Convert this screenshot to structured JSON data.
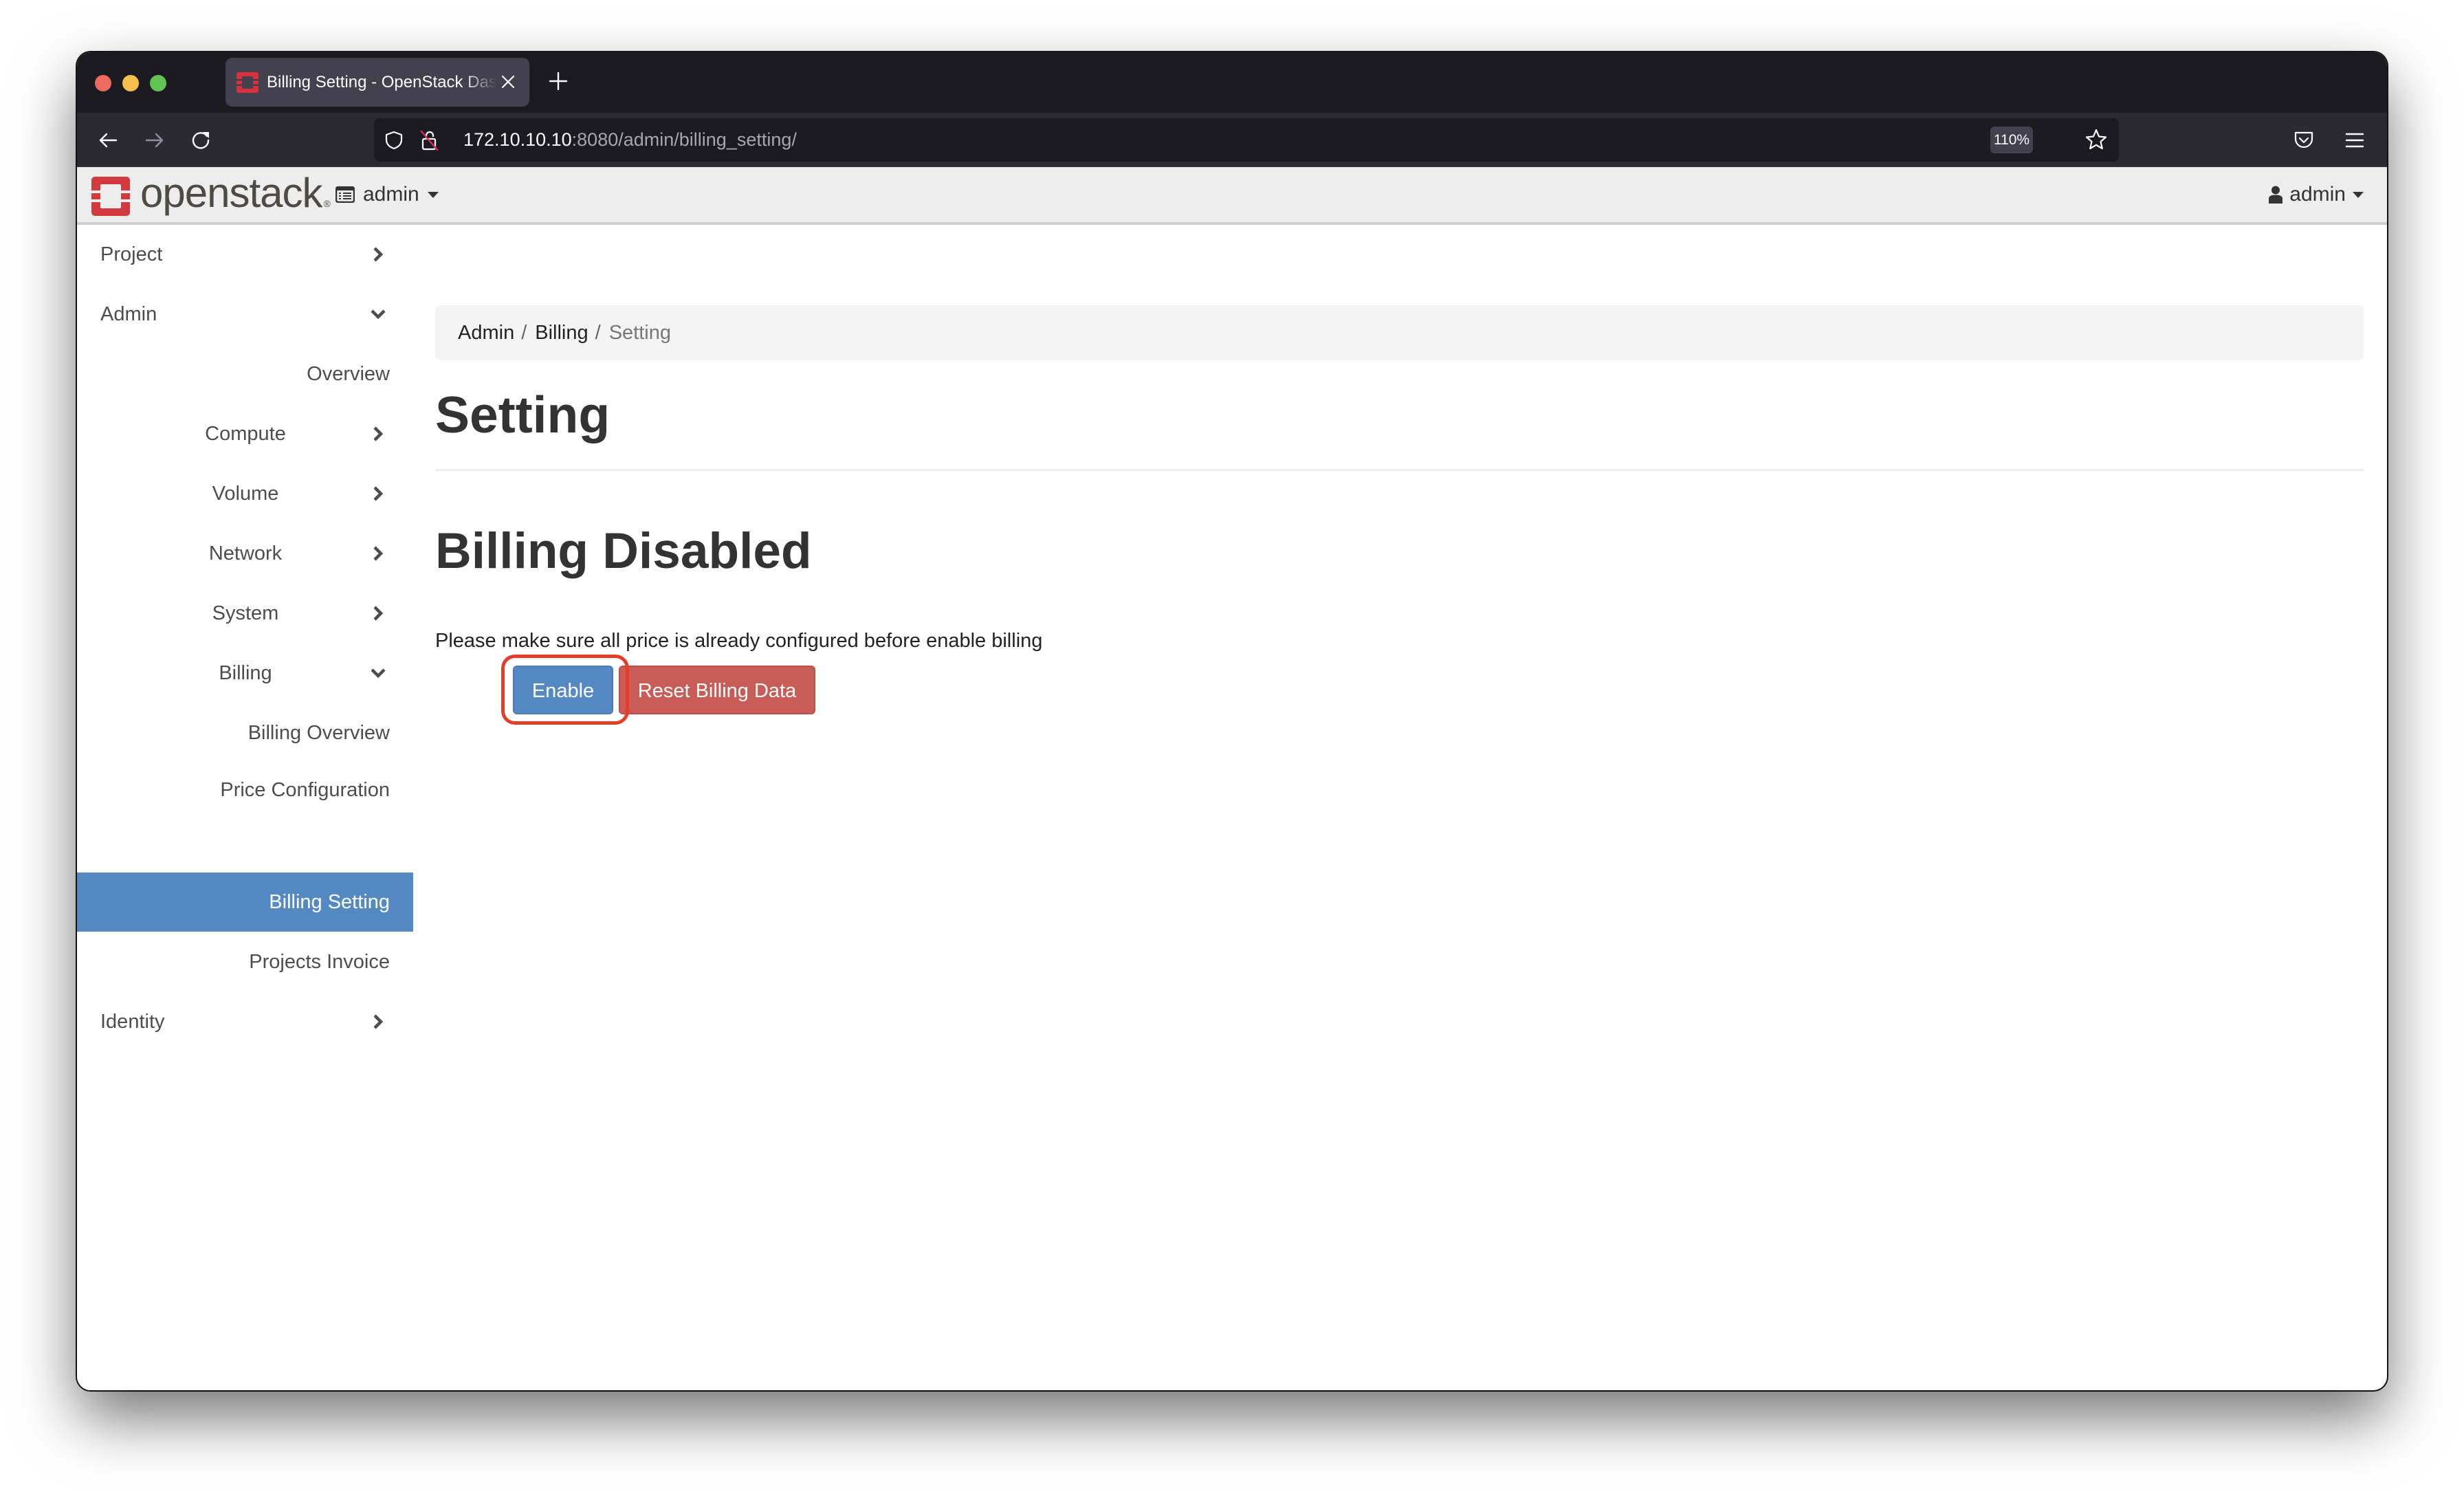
{
  "browser": {
    "tab": {
      "title": "Billing Setting - OpenStack Dashboard",
      "favicon": "openstack-logo-icon"
    },
    "new_tab_icon": "plus-icon",
    "nav_icons": [
      "arrow-left-icon",
      "arrow-right-icon",
      "reload-icon"
    ],
    "url": {
      "host": "172.10.10.10",
      "rest": ":8080/admin/billing_setting/",
      "security_icons": [
        "shield-icon",
        "insecure-lock-icon"
      ]
    },
    "zoom_level": "110%",
    "right_icons": [
      "bookmark-star-icon",
      "pocket-icon",
      "hamburger-menu-icon"
    ]
  },
  "header": {
    "brand": "openstack",
    "brand_mark": "®",
    "project_selector": {
      "icon": "project-list-icon",
      "label": "admin"
    },
    "user_menu": {
      "icon": "user-icon",
      "label": "admin"
    }
  },
  "sidebar": {
    "items": [
      {
        "label": "Project",
        "level": 0,
        "chevron": "right"
      },
      {
        "label": "Admin",
        "level": 0,
        "chevron": "down"
      },
      {
        "label": "Overview",
        "level": 1,
        "chevron": ""
      },
      {
        "label": "Compute",
        "level": 1,
        "chevron": "right"
      },
      {
        "label": "Volume",
        "level": 1,
        "chevron": "right"
      },
      {
        "label": "Network",
        "level": 1,
        "chevron": "right"
      },
      {
        "label": "System",
        "level": 1,
        "chevron": "right"
      },
      {
        "label": "Billing",
        "level": 1,
        "chevron": "down"
      },
      {
        "label": "Billing Overview",
        "level": 2,
        "chevron": ""
      },
      {
        "label": "Price Configuration",
        "level": 2,
        "chevron": ""
      },
      {
        "label": "Billing Setting",
        "level": 2,
        "chevron": "",
        "active": true
      },
      {
        "label": "Projects Invoice",
        "level": 2,
        "chevron": ""
      },
      {
        "label": "Identity",
        "level": 0,
        "chevron": "right"
      }
    ]
  },
  "breadcrumb": {
    "items": [
      "Admin",
      "Billing",
      "Setting"
    ],
    "separator": "/"
  },
  "page": {
    "title": "Setting",
    "section_title": "Billing Disabled",
    "help_text": "Please make sure all price is already configured before enable billing",
    "buttons": {
      "enable": "Enable",
      "reset": "Reset Billing Data"
    }
  },
  "colors": {
    "primary": "#5589c4",
    "danger": "#c95c56",
    "annotation": "#e43d28",
    "brand_red": "#da1a32"
  }
}
